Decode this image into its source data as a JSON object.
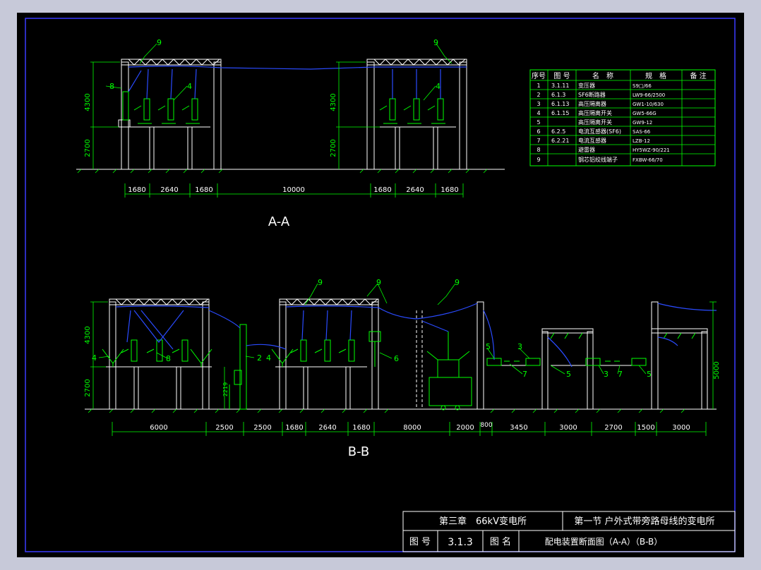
{
  "colors": {
    "page_bg": "#c7c9d9",
    "sheet_bg": "#000000",
    "frame": "#3a3aff",
    "structure": "#ffffff",
    "equipment": "#00ff00",
    "conductor": "#2a4bff",
    "dimension": "#00ff00",
    "text": "#ffffff"
  },
  "sections": {
    "aa_label": "A-A",
    "bb_label": "B-B"
  },
  "callouts": {
    "aa": [
      "9",
      "8",
      "4",
      "9",
      "4"
    ],
    "bb": [
      "9",
      "9",
      "9",
      "4",
      "8",
      "2",
      "4",
      "6",
      "5",
      "3",
      "7",
      "5",
      "3",
      "7",
      "5"
    ]
  },
  "dimensions": {
    "aa_h": [
      "1680",
      "2640",
      "1680",
      "10000",
      "1680",
      "2640",
      "1680"
    ],
    "aa_v_left": [
      "4300",
      "2700"
    ],
    "aa_v_mid": [
      "4300",
      "2700"
    ],
    "bb_h": [
      "6000",
      "2500",
      "2500",
      "1680",
      "2640",
      "1680",
      "8000",
      "2000",
      "800",
      "3450",
      "3000",
      "2700",
      "1500",
      "3000"
    ],
    "bb_v_left": [
      "4300",
      "2700"
    ],
    "bb_v_small": "2219",
    "bb_v_right": "5000"
  },
  "equipment_table": {
    "headers": [
      "序号",
      "图 号",
      "名　称",
      "规　格",
      "备 注"
    ],
    "rows": [
      [
        "1",
        "3.1.11",
        "变压器",
        "S9□/66",
        ""
      ],
      [
        "2",
        "6.1.3",
        "SF6断路器",
        "LW9-66/2500",
        ""
      ],
      [
        "3",
        "6.1.13",
        "高压隔离器",
        "GW1-10/630",
        ""
      ],
      [
        "4",
        "6.1.15",
        "高压隔离开关",
        "GW5-66G",
        ""
      ],
      [
        "5",
        "",
        "高压隔离开关",
        "GW9-12",
        ""
      ],
      [
        "6",
        "6.2.5",
        "电流互感器(SF6)",
        "SAS-66",
        ""
      ],
      [
        "7",
        "6.2.21",
        "电流互感器",
        "LZB-12",
        ""
      ],
      [
        "8",
        "",
        "避雷器",
        "HY5WZ-90/221",
        ""
      ],
      [
        "9",
        "",
        "钢芯铝绞线端子",
        "FXBW-66/70",
        ""
      ]
    ]
  },
  "title_block": {
    "chapter": "第三章　66kV变电所",
    "section": "第一节 户外式带旁路母线的变电所",
    "drawing_no_label": "图 号",
    "drawing_no": "3.1.3",
    "drawing_name_label": "图 名",
    "drawing_name": "配电装置断面图（A-A）（B-B）"
  }
}
